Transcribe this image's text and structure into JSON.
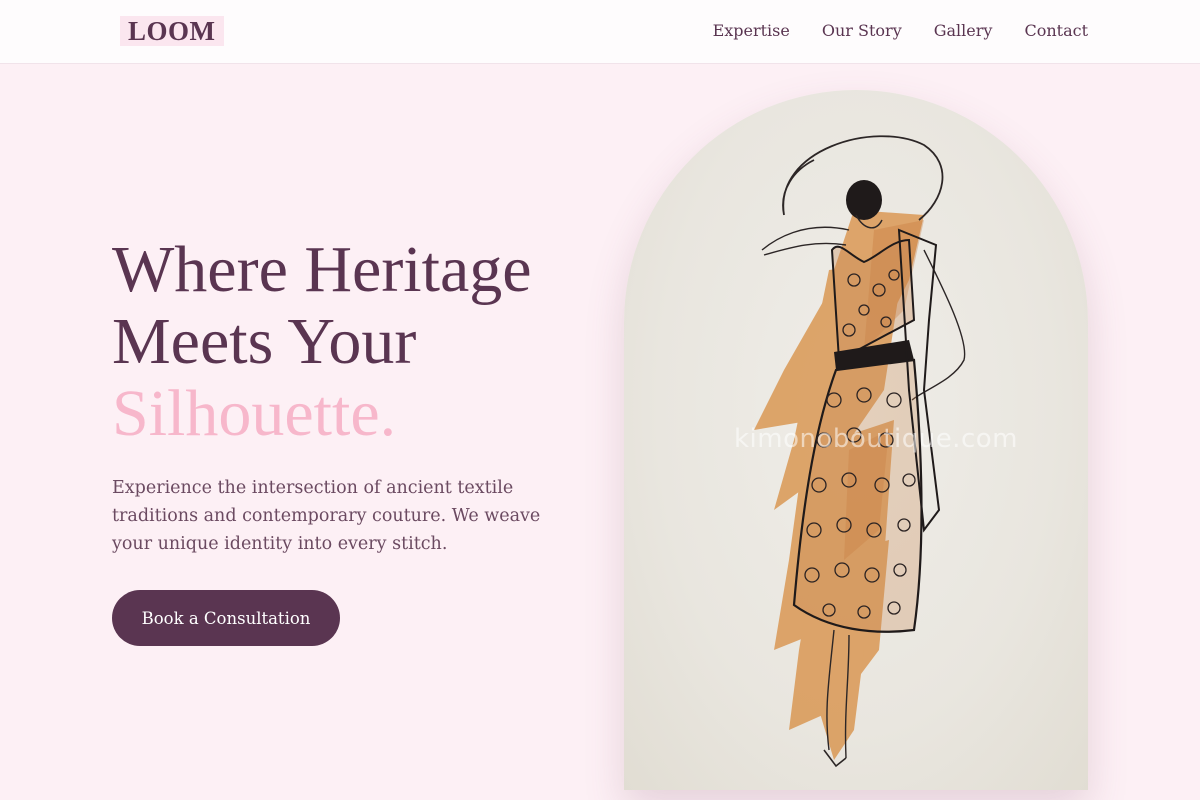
{
  "brand": {
    "logo": "LOOM"
  },
  "nav": {
    "items": [
      {
        "label": "Expertise"
      },
      {
        "label": "Our Story"
      },
      {
        "label": "Gallery"
      },
      {
        "label": "Contact"
      }
    ]
  },
  "hero": {
    "title_line1": "Where Heritage",
    "title_line2": "Meets Your",
    "title_accent": "Silhouette.",
    "description": "Experience the intersection of ancient textile traditions and contemporary couture. We weave your unique identity into every stitch.",
    "cta_label": "Book a Consultation"
  },
  "image": {
    "subject": "fashion-sketch-illustration",
    "watermark": "kimonoboutique.com"
  },
  "colors": {
    "primary": "#5a3551",
    "accent": "#f7b7cb",
    "background": "#fdf0f5"
  }
}
